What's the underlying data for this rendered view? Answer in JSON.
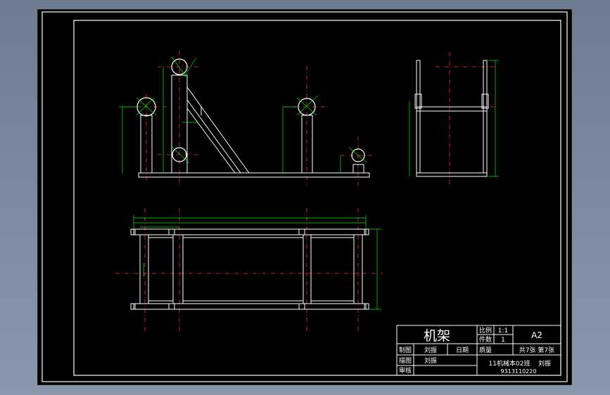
{
  "title_block": {
    "drawing_name": "机架",
    "scale_label": "比例",
    "scale_value": "1:1",
    "qty_label": "件数",
    "qty_value": "1",
    "paper_size": "A2",
    "drawn_label": "制图",
    "drawn_name": "刘振",
    "date_label": "日期",
    "weight_label": "质量",
    "sheet_info": "共7张 第7张",
    "traced_label": "描图",
    "traced_name": "刘振",
    "class_name": "11机械本02班",
    "student_name": "刘振",
    "student_id": "9313110220",
    "checked_label": "审核"
  },
  "colors": {
    "background": "#000000",
    "outline": "#ffffff",
    "dimension": "#00ff00",
    "centerline": "#ff0000"
  }
}
